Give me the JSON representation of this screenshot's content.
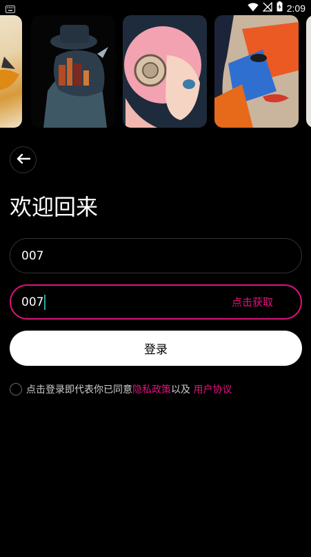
{
  "status_bar": {
    "time": "2:09",
    "icons": [
      "keyboard-icon",
      "wifi-icon",
      "signal-off-icon",
      "battery-icon"
    ]
  },
  "gallery": {
    "images": [
      "bird-artwork",
      "rhino-city-artwork",
      "robot-girl-artwork",
      "colorful-face-artwork",
      "partial-artwork"
    ]
  },
  "header": {
    "back_icon": "arrow-left-icon",
    "title": "欢迎回来"
  },
  "form": {
    "phone_value": "007",
    "code_value": "007",
    "get_code_label": "点击获取",
    "login_label": "登录"
  },
  "agreement": {
    "prefix": "点击登录即代表你已同意",
    "privacy_link": "隐私政策",
    "middle": "以及 ",
    "terms_link": "用户协议"
  },
  "colors": {
    "accent": "#e2127f",
    "background": "#000000",
    "button": "#ffffff"
  }
}
